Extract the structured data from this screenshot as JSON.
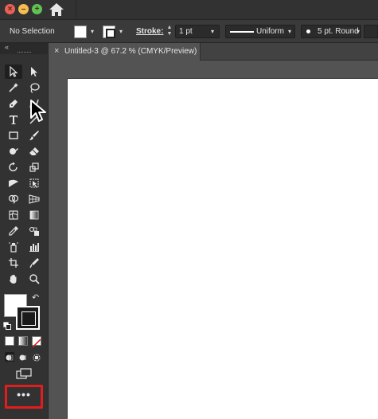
{
  "control_bar": {
    "selection_label": "No Selection",
    "stroke_label": "Stroke:",
    "stroke_weight": "1 pt",
    "profile_label": "Uniform",
    "brush_label": "5 pt. Round"
  },
  "document_tab": {
    "close_glyph": "×",
    "title": "Untitled-3 @ 67.2 % (CMYK/Preview)"
  },
  "toolbar": {
    "collapse_glyph": "«",
    "more_tools_label": "•••"
  },
  "colors": {
    "traffic_close": "#ec5f56",
    "traffic_minimize": "#f4bd4f",
    "traffic_maximize": "#5fc454",
    "highlight": "#e11d1d",
    "fill": "#ffffff",
    "stroke": "#000000"
  },
  "icons": [
    "home-icon",
    "selection-tool-icon",
    "direct-selection-tool-icon",
    "magic-wand-icon",
    "lasso-icon",
    "pen-tool-icon",
    "curvature-tool-icon",
    "type-tool-icon",
    "line-segment-icon",
    "rectangle-tool-icon",
    "paintbrush-icon",
    "shaper-tool-icon",
    "eraser-icon",
    "rotate-tool-icon",
    "scale-tool-icon",
    "width-tool-icon",
    "free-transform-icon",
    "shape-builder-icon",
    "perspective-grid-icon",
    "mesh-tool-icon",
    "gradient-tool-icon",
    "eyedropper-icon",
    "blend-tool-icon",
    "symbol-sprayer-icon",
    "column-graph-icon",
    "artboard-tool-icon",
    "slice-tool-icon",
    "hand-tool-icon",
    "zoom-tool-icon",
    "swap-fill-stroke-icon",
    "default-fill-stroke-icon",
    "color-icon",
    "gradient-icon",
    "none-icon",
    "draw-normal-icon",
    "draw-behind-icon",
    "draw-inside-icon",
    "change-screen-mode-icon",
    "more-tools-icon"
  ]
}
